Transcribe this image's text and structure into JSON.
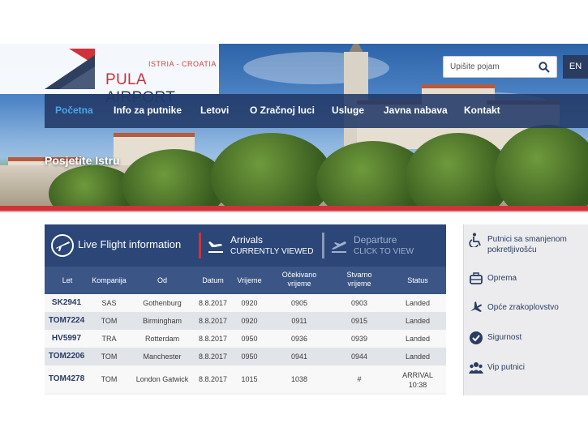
{
  "header": {
    "logo_sub": "ISTRIA - CROATIA",
    "logo_name_red": "PULA",
    "logo_name_rest": " AIRPORT",
    "search_placeholder": "Upišite pojam",
    "lang": "EN"
  },
  "nav": {
    "items": [
      {
        "label": "Početna",
        "active": true
      },
      {
        "label": "Info za putnike"
      },
      {
        "label": "Letovi"
      },
      {
        "label": "O Zračnoj luci"
      },
      {
        "label": "Usluge"
      },
      {
        "label": "Javna nabava"
      },
      {
        "label": "Kontakt"
      }
    ]
  },
  "hero": {
    "title": "Posjetite Istru"
  },
  "flights": {
    "live_label": "Live Flight information",
    "arrivals_title": "Arrivals",
    "arrivals_sub": "CURRENTLY VIEWED",
    "departure_title": "Departure",
    "departure_sub": "CLICK TO VIEW",
    "columns": [
      "Let",
      "Kompanija",
      "Od",
      "Datum",
      "Vrijeme",
      "Očekivano vrijeme",
      "Stvarno vrijeme",
      "Status"
    ],
    "rows": [
      [
        "SK2941",
        "SAS",
        "Gothenburg",
        "8.8.2017",
        "0920",
        "0905",
        "0903",
        "Landed"
      ],
      [
        "TOM7224",
        "TOM",
        "Birmingham",
        "8.8.2017",
        "0920",
        "0911",
        "0915",
        "Landed"
      ],
      [
        "HV5997",
        "TRA",
        "Rotterdam",
        "8.8.2017",
        "0950",
        "0936",
        "0939",
        "Landed"
      ],
      [
        "TOM2206",
        "TOM",
        "Manchester",
        "8.8.2017",
        "0950",
        "0941",
        "0944",
        "Landed"
      ],
      [
        "TOM4278",
        "TOM",
        "London Gatwick",
        "8.8.2017",
        "1015",
        "1038",
        "#",
        "ARRIVAL 10:38"
      ]
    ]
  },
  "sidebar": {
    "items": [
      {
        "label": "Putnici sa smanjenom pokretljivošću",
        "icon": "wheelchair-icon"
      },
      {
        "label": "Oprema",
        "icon": "luggage-icon"
      },
      {
        "label": "Opće zrakoplovstvo",
        "icon": "plane-icon"
      },
      {
        "label": "Sigurnost",
        "icon": "check-badge-icon"
      },
      {
        "label": "Vip putnici",
        "icon": "group-icon"
      }
    ]
  },
  "colors": {
    "navy": "#2b4677",
    "red": "#d0323a",
    "accent": "#4aa6ea"
  }
}
